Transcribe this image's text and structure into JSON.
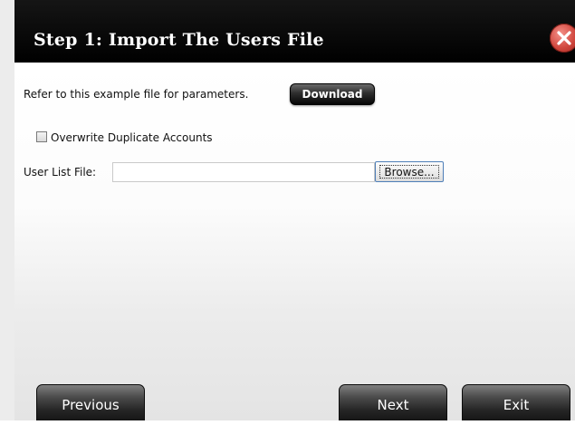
{
  "dialog": {
    "title": "Step 1: Import The Users File",
    "close_icon": "close-icon",
    "accent_colors": {
      "titlebar": "#000000",
      "close": "#d0473e"
    }
  },
  "content": {
    "refer_text": "Refer to this example file for parameters.",
    "download_label": "Download",
    "overwrite_label": "Overwrite Duplicate Accounts",
    "overwrite_checked": false,
    "user_list_label": "User List File:",
    "user_list_value": "",
    "browse_label": "Browse..."
  },
  "footer": {
    "previous_label": "Previous",
    "next_label": "Next",
    "exit_label": "Exit"
  }
}
